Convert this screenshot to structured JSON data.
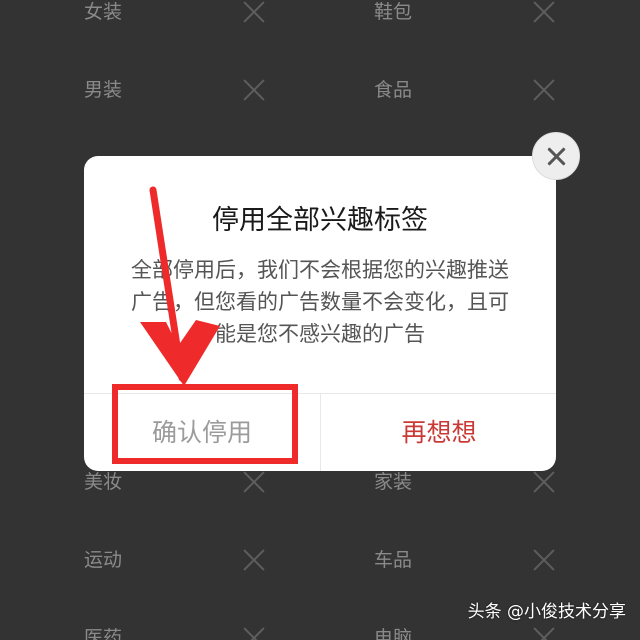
{
  "background_tags": {
    "row0": {
      "left": "女装",
      "right": "鞋包"
    },
    "row1": {
      "left": "男装",
      "right": "食品"
    },
    "row2": {
      "left": "美妆",
      "right": "家装"
    },
    "row3": {
      "left": "运动",
      "right": "车品"
    },
    "row4": {
      "left": "医药",
      "right": "电脑"
    }
  },
  "dialog": {
    "title": "停用全部兴趣标签",
    "body_line1": "全部停用后，我们不会根据您的兴趣推送",
    "body_line2": "广告，但您看的广告数量不会变化，且可",
    "body_line3": "能是您不感兴趣的广告",
    "confirm_label": "确认停用",
    "cancel_label": "再想想"
  },
  "watermark": "头条 @小俊技术分享",
  "colors": {
    "annotation": "#ef2a2a",
    "cancel_text": "#c93a36",
    "overlay_bg": "#333333"
  },
  "icons": {
    "close": "close-icon",
    "remove_tag": "x-icon",
    "annotation_arrow": "arrow-icon"
  }
}
